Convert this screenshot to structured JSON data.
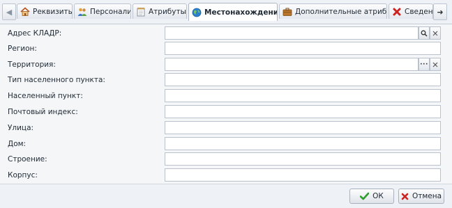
{
  "tabs": [
    {
      "label": "Реквизиты",
      "icon": "house-icon"
    },
    {
      "label": "Персоналии",
      "icon": "users-icon"
    },
    {
      "label": "Атрибуты",
      "icon": "notepad-icon"
    },
    {
      "label": "Местонахождение",
      "icon": "globe-icon",
      "active": true
    },
    {
      "label": "Дополнительные атрибуты",
      "icon": "briefcase-icon"
    },
    {
      "label": "Сведения",
      "icon": "red-x-icon"
    }
  ],
  "fields": [
    {
      "label": "Адрес КЛАДР:",
      "value": "",
      "buttons": [
        "search-icon",
        "clear-icon"
      ]
    },
    {
      "label": "Регион:",
      "value": ""
    },
    {
      "label": "Территория:",
      "value": "",
      "buttons": [
        "ellipsis-icon",
        "clear-icon"
      ]
    },
    {
      "label": "Тип населенного пункта:",
      "value": ""
    },
    {
      "label": "Населенный пункт:",
      "value": ""
    },
    {
      "label": "Почтовый индекс:",
      "value": ""
    },
    {
      "label": "Улица:",
      "value": ""
    },
    {
      "label": "Дом:",
      "value": ""
    },
    {
      "label": "Строение:",
      "value": ""
    },
    {
      "label": "Корпус:",
      "value": ""
    }
  ],
  "buttons": {
    "ok": "ОК",
    "cancel": "Отмена"
  },
  "colors": {
    "ok_check": "#2e9e2e",
    "cancel_x": "#cc2222",
    "globe": "#2b7fd0"
  }
}
